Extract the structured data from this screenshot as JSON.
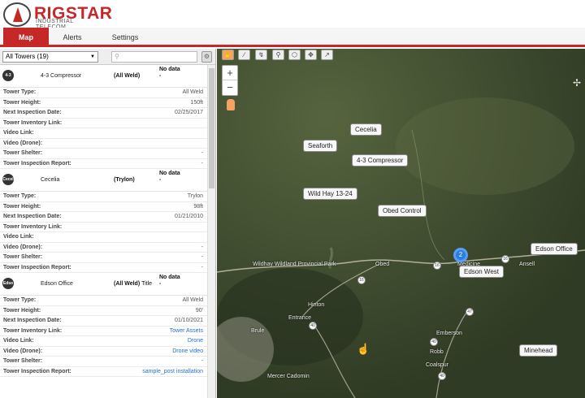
{
  "brand": {
    "name_main": "RIGSTAR",
    "name_sub": "INDUSTRIAL TELECOM"
  },
  "tabs": [
    {
      "label": "Map"
    },
    {
      "label": "Alerts"
    },
    {
      "label": "Settings"
    }
  ],
  "filter": {
    "selected": "All Towers (19)",
    "search_placeholder": ""
  },
  "field_labels": {
    "tower_type": "Tower Type:",
    "tower_height": "Tower Height:",
    "next_inspection": "Next Inspection Date:",
    "inventory_link": "Tower Inventory Link:",
    "video_link": "Video Link:",
    "video_drone": "Video (Drone):",
    "shelter": "Tower Shelter:",
    "inspection_report": "Tower Inspection Report:"
  },
  "towers": [
    {
      "icon": "4-3",
      "name": "4-3 Compressor",
      "type_badge": "(All Weld)",
      "status": "No data",
      "status_sub": "-",
      "tower_type": "All Weld",
      "tower_height": "150ft",
      "next_inspection": "02/25/2017",
      "inventory_link": "",
      "video_link": "",
      "video_drone": "",
      "shelter": "-",
      "inspection_report": "-"
    },
    {
      "icon": "Cecel",
      "name": "Cecelia",
      "type_badge": "(Trylon)",
      "status": "No data",
      "status_sub": "-",
      "tower_type": "Trylon",
      "tower_height": "98ft",
      "next_inspection": "01/21/2010",
      "inventory_link": "",
      "video_link": "",
      "video_drone": "-",
      "shelter": "-",
      "inspection_report": "-"
    },
    {
      "icon": "Edso",
      "name": "Edson Office",
      "type_badge": "(All Weld)",
      "type_extra": "Title",
      "status": "No data",
      "status_sub": "-",
      "tower_type": "All Weld",
      "tower_height": "90'",
      "next_inspection": "01/10/2021",
      "inventory_link": "Tower Assets",
      "video_link": "Drone",
      "video_drone": "Drone video",
      "shelter": "-",
      "inspection_report": "sample_post installation"
    }
  ],
  "map": {
    "zoom_in": "+",
    "zoom_out": "−",
    "tower_labels": [
      {
        "text": "Cecelia"
      },
      {
        "text": "Seaforth"
      },
      {
        "text": "4-3 Compressor"
      },
      {
        "text": "Wild Hay 13-24"
      },
      {
        "text": "Obed Control"
      },
      {
        "text": "Edson Office"
      },
      {
        "text": "Edson West"
      },
      {
        "text": "Minehead"
      }
    ],
    "cluster_count": "2",
    "places": [
      "Wildhay Wildland Provincial Park",
      "Obed",
      "Medicine",
      "Ansell",
      "Hinton",
      "Entrance",
      "Brule",
      "Emberson",
      "Robb",
      "Coalspur",
      "Mercer Cadomin"
    ],
    "highways": [
      "16",
      "16",
      "16",
      "40",
      "47",
      "40",
      "40"
    ]
  },
  "colors": {
    "accent": "#c62828",
    "link": "#1e6fd9",
    "cluster": "#2a7de1"
  }
}
